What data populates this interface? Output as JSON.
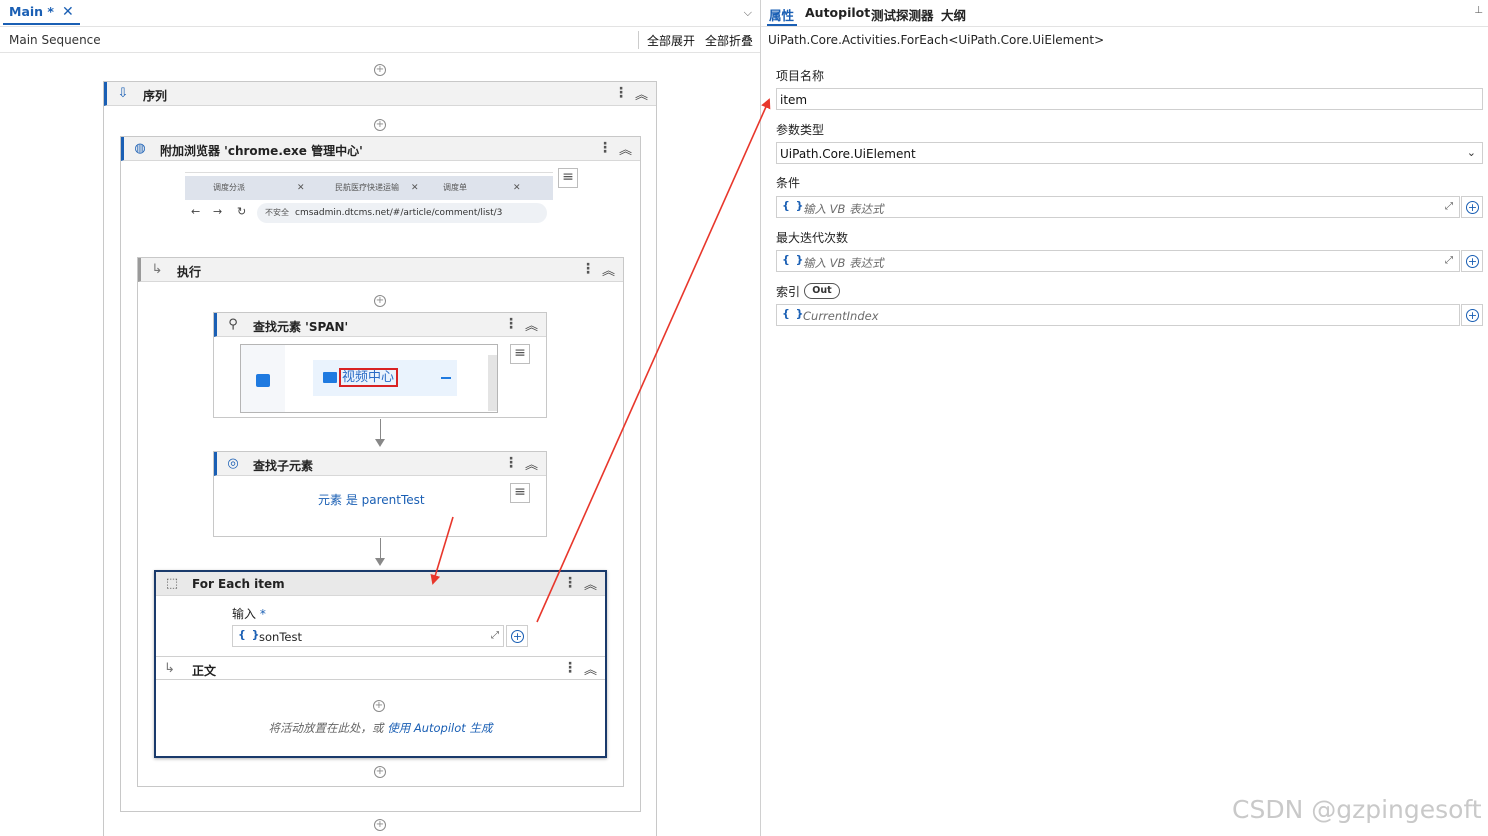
{
  "designer": {
    "tab_title": "Main *",
    "breadcrumb": "Main Sequence",
    "expand_all": "全部展开",
    "collapse_all": "全部折叠"
  },
  "activities": {
    "sequence": {
      "title": "序列"
    },
    "attach_browser": {
      "title": "附加浏览器 'chrome.exe  管理中心'",
      "thumb_tabs": [
        "调度分派",
        "民航医疗快递运输",
        "调度单"
      ],
      "thumb_url_warning": "不安全",
      "thumb_url": "cmsadmin.dtcms.net/#/article/comment/list/3"
    },
    "do": {
      "title": "执行"
    },
    "find_element": {
      "title": "查找元素 'SPAN'",
      "thumb_text": "视频中心"
    },
    "find_children": {
      "title": "查找子元素",
      "summary": "元素 是 parentTest"
    },
    "for_each": {
      "title": "For Each item",
      "input_label": "输入",
      "required_mark": "*",
      "input_value": "sonTest",
      "body_title": "正文",
      "drop_hint": "将活动放置在此处，或",
      "autopilot_link": "使用 Autopilot 生成"
    }
  },
  "panel": {
    "tabs": [
      "属性",
      "Autopilot",
      "测试探测器",
      "大纲"
    ],
    "active_tab": "属性",
    "type_name": "UiPath.Core.Activities.ForEach<UiPath.Core.UiElement>",
    "fields": {
      "item_name": {
        "label": "项目名称",
        "value": "item"
      },
      "arg_type": {
        "label": "参数类型",
        "value": "UiPath.Core.UiElement"
      },
      "condition": {
        "label": "条件",
        "placeholder": "输入 VB 表达式"
      },
      "max_iterations": {
        "label": "最大迭代次数",
        "placeholder": "输入 VB 表达式"
      },
      "index": {
        "label": "索引",
        "badge": "Out",
        "placeholder": "CurrentIndex"
      }
    }
  },
  "watermark": "CSDN @gzpingesoft",
  "colors": {
    "accent": "#1a5fb4",
    "annotation": "#e8372c"
  }
}
